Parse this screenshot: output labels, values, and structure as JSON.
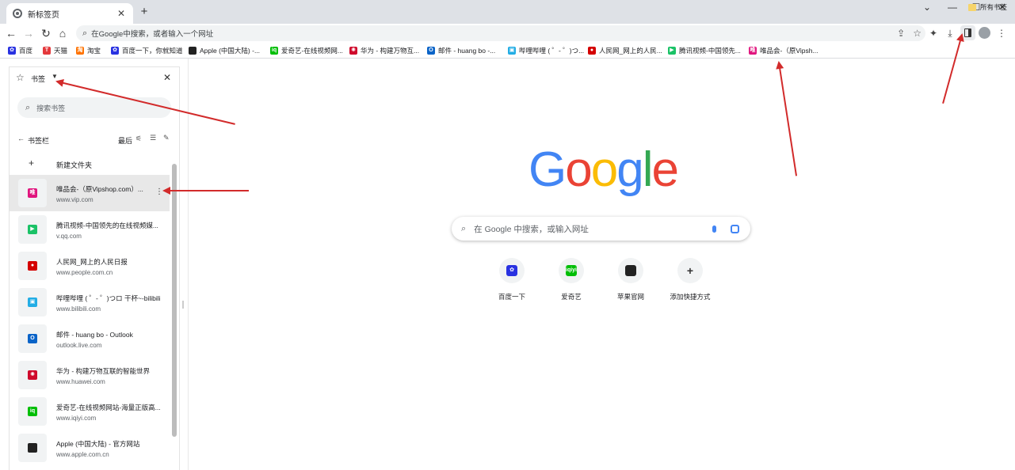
{
  "tab": {
    "title": "新标签页",
    "close": "✕",
    "new": "+"
  },
  "window": {
    "min": "⌄",
    "minimize": "—",
    "maximize": "☐",
    "close": "✕"
  },
  "toolbar": {
    "back": "←",
    "forward": "→",
    "reload": "↻",
    "home": "⌂",
    "omnibox_text": "在Google中搜索，或者输入一个网址"
  },
  "bookmarks_bar": [
    {
      "label": "百度",
      "icon": "baidu-icon",
      "color": "#2932e1",
      "glyph": "✿"
    },
    {
      "label": "天猫",
      "icon": "tmall-icon",
      "color": "#e4393c",
      "glyph": "T"
    },
    {
      "label": "淘宝",
      "icon": "taobao-icon",
      "color": "#ff7300",
      "glyph": "淘"
    },
    {
      "label": "百度一下，你就知道",
      "icon": "baidu-icon",
      "color": "#2932e1",
      "glyph": "✿"
    },
    {
      "label": "Apple (中国大陆) -...",
      "icon": "apple-icon",
      "color": "#222222",
      "glyph": ""
    },
    {
      "label": "爱奇艺-在线视频网...",
      "icon": "iqiyi-icon",
      "color": "#00be06",
      "glyph": "iq"
    },
    {
      "label": "华为 - 构建万物互...",
      "icon": "huawei-icon",
      "color": "#cf0a2c",
      "glyph": "✺"
    },
    {
      "label": "邮件 - huang bo -...",
      "icon": "outlook-icon",
      "color": "#0a64c8",
      "glyph": "O"
    },
    {
      "label": "哔哩哔哩 ( ゜- ゜)つ...",
      "icon": "bilibili-icon",
      "color": "#23ade5",
      "glyph": "▣"
    },
    {
      "label": "人民网_网上的人民...",
      "icon": "people-icon",
      "color": "#d40000",
      "glyph": "●"
    },
    {
      "label": "腾讯视频-中国领先...",
      "icon": "tencent-video-icon",
      "color": "#1bc267",
      "glyph": "▶"
    },
    {
      "label": "唯品会-（原Vipsh...",
      "icon": "vipshop-icon",
      "color": "#e0157e",
      "glyph": "唯"
    }
  ],
  "all_bookmarks": "所有书签",
  "panel": {
    "title": "书签",
    "search_placeholder": "搜索书签",
    "folder": "书签栏",
    "sort": "最后",
    "new_folder": "新建文件夹",
    "items": [
      {
        "title": "唯品会-（原Vipshop.com）...",
        "url": "www.vip.com",
        "icon": "vipshop-icon",
        "color": "#e0157e",
        "glyph": "唯"
      },
      {
        "title": "腾讯视频-中国领先的在线视频媒...",
        "url": "v.qq.com",
        "icon": "tencent-video-icon",
        "color": "#1bc267",
        "glyph": "▶"
      },
      {
        "title": "人民网_网上的人民日报",
        "url": "www.people.com.cn",
        "icon": "people-icon",
        "color": "#d40000",
        "glyph": "●"
      },
      {
        "title": "哔哩哔哩 ( ゜- ゜)つロ 干杯~-bilibili",
        "url": "www.bilibili.com",
        "icon": "bilibili-icon",
        "color": "#23ade5",
        "glyph": "▣"
      },
      {
        "title": "邮件 - huang bo - Outlook",
        "url": "outlook.live.com",
        "icon": "outlook-icon",
        "color": "#0a64c8",
        "glyph": "O"
      },
      {
        "title": "华为 - 构建万物互联的智能世界",
        "url": "www.huawei.com",
        "icon": "huawei-icon",
        "color": "#cf0a2c",
        "glyph": "✺"
      },
      {
        "title": "爱奇艺-在线视频网站-海量正版高...",
        "url": "www.iqiyi.com",
        "icon": "iqiyi-icon",
        "color": "#00be06",
        "glyph": "iq"
      },
      {
        "title": "Apple (中国大陆) - 官方网站",
        "url": "www.apple.com.cn",
        "icon": "apple-icon",
        "color": "#222222",
        "glyph": ""
      }
    ]
  },
  "google": {
    "logo": [
      {
        "ch": "G",
        "color": "#4285f4"
      },
      {
        "ch": "o",
        "color": "#ea4335"
      },
      {
        "ch": "o",
        "color": "#fbbc05"
      },
      {
        "ch": "g",
        "color": "#4285f4"
      },
      {
        "ch": "l",
        "color": "#34a853"
      },
      {
        "ch": "e",
        "color": "#ea4335"
      }
    ],
    "search_placeholder": "在 Google 中搜索，或输入网址",
    "shortcuts": [
      {
        "label": "百度一下",
        "icon": "baidu-icon",
        "color": "#2932e1",
        "glyph": "✿"
      },
      {
        "label": "爱奇艺",
        "icon": "iqiyi-icon",
        "color": "#00be06",
        "glyph": "iqiyi"
      },
      {
        "label": "苹果官网",
        "icon": "apple-icon",
        "color": "#222222",
        "glyph": ""
      },
      {
        "label": "添加快捷方式",
        "icon": "plus-icon",
        "color": "#f1f3f4",
        "glyph": "+"
      }
    ]
  },
  "annotation_color": "#d22b2b"
}
